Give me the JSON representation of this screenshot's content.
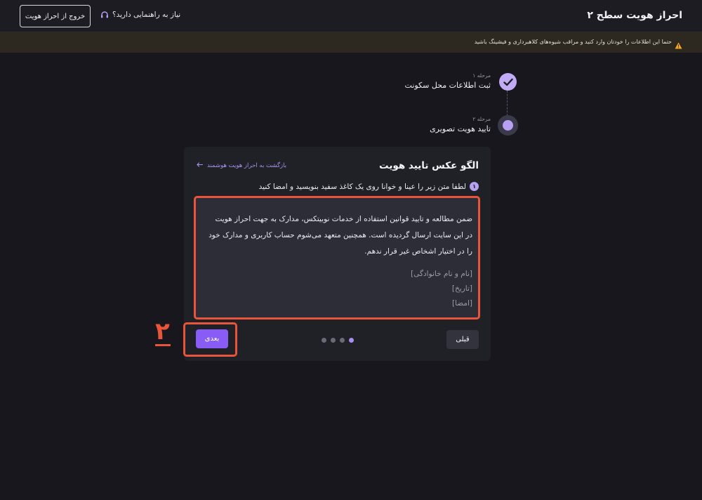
{
  "header": {
    "title": "احراز هویت سطح ۲",
    "exit_label": "خروج از احراز هویت",
    "help_label": "نیاز به راهنمایی دارید؟"
  },
  "warning": {
    "text": "حتما این اطلاعات را خودتان وارد کنید و مراقب شیوه‌های کلاهبرداری و فیشینگ باشید"
  },
  "steps": [
    {
      "caption": "مرحله ۱",
      "label": "ثبت اطلاعات محل سکونت",
      "status": "done"
    },
    {
      "caption": "مرحله ۲",
      "label": "تایید هویت تصویری",
      "status": "current"
    }
  ],
  "card": {
    "title": "الگو عکس تایید هویت",
    "back_label": "بازگشت به احراز هویت هوشمند",
    "step_number": "۱",
    "instruction": "لطفا متن زیر را عینا و خوانا روی یک کاغذ سفید بنویسید و امضا کنید",
    "text_lines": [
      "ضمن مطالعه و تایید قوانین استفاده از خدمات نوبیتکس، مدارک به جهت احراز هویت",
      "در این سایت ارسال گردیده است. همچنین متعهد می‌شوم حساب کاربری و مدارک خود",
      "را در اختیار اشخاص غیر قرار ندهم."
    ],
    "placeholders": [
      "[نام و نام خانوادگی]",
      "[تاریخ]",
      "[امضا]"
    ],
    "pagination": {
      "total": 4,
      "active_index": 3
    },
    "prev_label": "قبلی",
    "next_label": "بعدی"
  },
  "annotation": {
    "marker": "۲",
    "color": "#e8553a"
  },
  "colors": {
    "accent": "#8a5cf6",
    "accent_light": "#b8a0f3",
    "highlight": "#e8553a",
    "warning_icon": "#f5a623"
  }
}
